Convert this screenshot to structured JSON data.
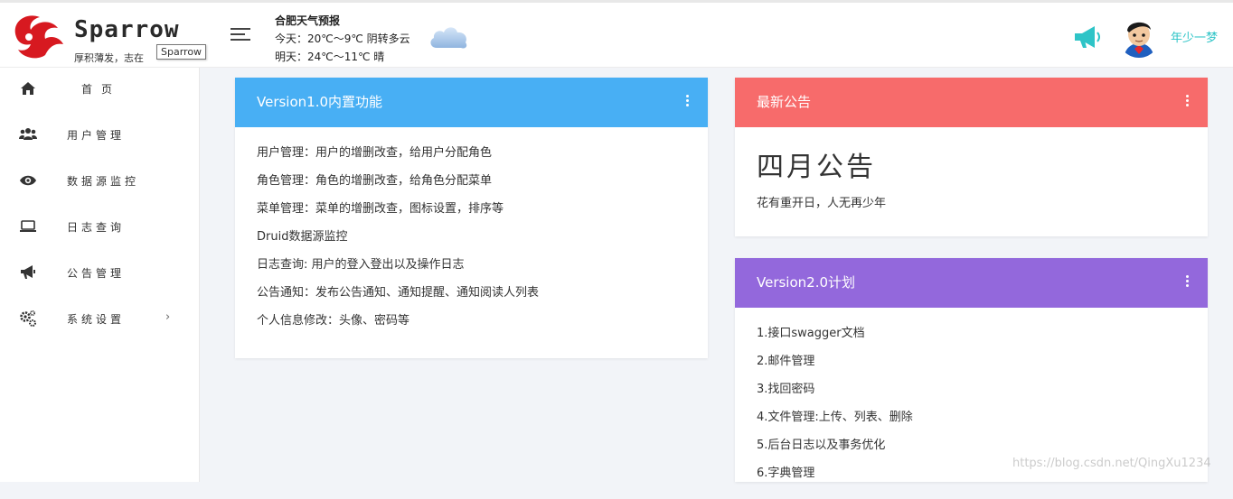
{
  "header": {
    "logo_name": "Sparrow",
    "logo_slogan": "厚积薄发，志在",
    "tooltip": "Sparrow",
    "weather": {
      "title": "合肥天气预报",
      "today": "今天：20℃～9℃ 阴转多云",
      "tomorrow": "明天：24℃～11℃ 晴"
    },
    "username": "年少一梦"
  },
  "sidebar": {
    "items": [
      {
        "label": "首页",
        "icon": "home-icon"
      },
      {
        "label": "用户管理",
        "icon": "users-icon"
      },
      {
        "label": "数据源监控",
        "icon": "eye-icon"
      },
      {
        "label": "日志查询",
        "icon": "laptop-icon"
      },
      {
        "label": "公告管理",
        "icon": "bullhorn-icon"
      },
      {
        "label": "系统设置",
        "icon": "gears-icon",
        "chevron": "›"
      }
    ]
  },
  "cards": {
    "v1": {
      "title": "Version1.0内置功能",
      "lines": [
        "用户管理：用户的增删改查，给用户分配角色",
        "角色管理：角色的增删改查，给角色分配菜单",
        "菜单管理：菜单的增删改查，图标设置，排序等",
        "Druid数据源监控",
        "日志查询: 用户的登入登出以及操作日志",
        "公告通知：发布公告通知、通知提醒、通知阅读人列表",
        "个人信息修改：头像、密码等"
      ]
    },
    "notice": {
      "title": "最新公告",
      "headline": "四月公告",
      "text": "花有重开日，人无再少年"
    },
    "v2": {
      "title": "Version2.0计划",
      "lines": [
        "1.接口swagger文档",
        "2.邮件管理",
        "3.找回密码",
        "4.文件管理:上传、列表、删除",
        "5.后台日志以及事务优化",
        "6.字典管理"
      ]
    }
  },
  "watermark": "https://blog.csdn.net/QingXu1234",
  "colors": {
    "blue": "#48aff4",
    "red": "#f76b6b",
    "purple": "#9368dc",
    "teal": "#2ec4c7"
  }
}
